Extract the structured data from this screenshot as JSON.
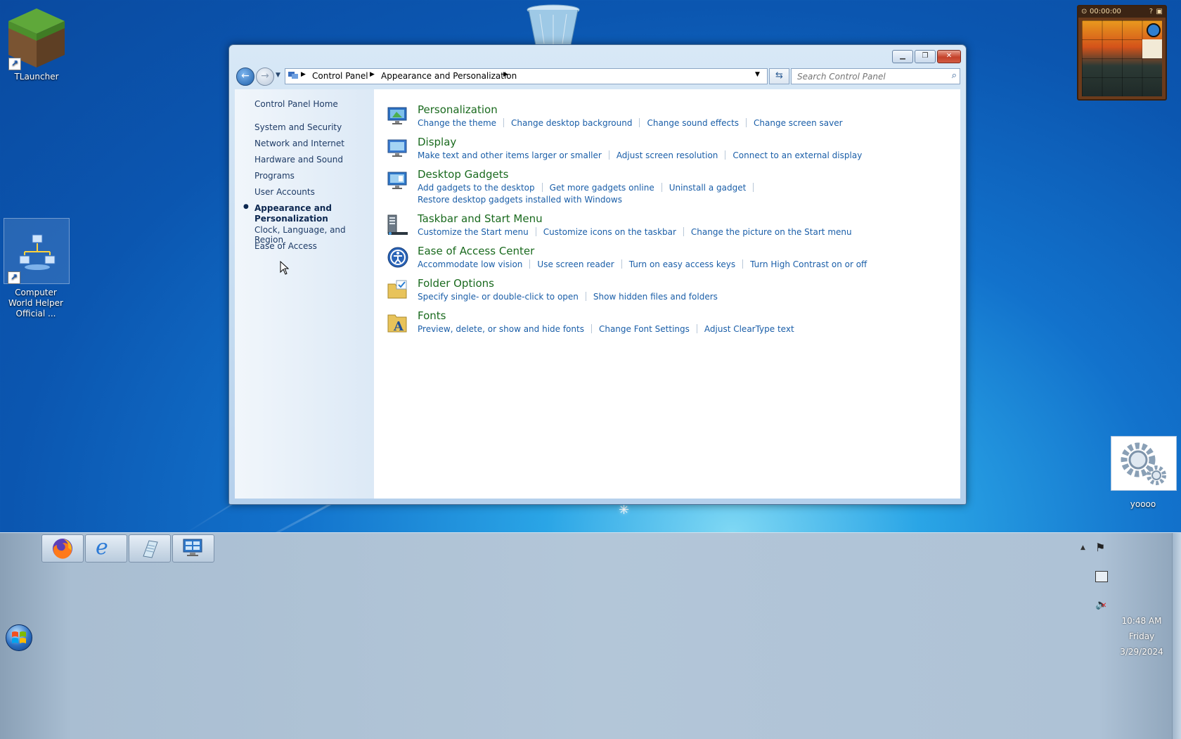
{
  "desktop": {
    "icons": [
      {
        "label": "TLauncher"
      },
      {
        "label": "Computer World Helper Official ..."
      },
      {
        "label": "yoooo"
      }
    ],
    "gadget_timer": "00:00:00"
  },
  "window": {
    "breadcrumb": [
      "Control Panel",
      "Appearance and Personalization"
    ],
    "search_placeholder": "Search Control Panel",
    "left_nav": {
      "home": "Control Panel Home",
      "items": [
        "System and Security",
        "Network and Internet",
        "Hardware and Sound",
        "Programs",
        "User Accounts",
        "Appearance and Personalization",
        "Clock, Language, and Region",
        "Ease of Access"
      ],
      "selected": "Appearance and Personalization"
    },
    "categories": [
      {
        "title": "Personalization",
        "icon": "personalization-icon",
        "links": [
          "Change the theme",
          "Change desktop background",
          "Change sound effects",
          "Change screen saver"
        ]
      },
      {
        "title": "Display",
        "icon": "display-icon",
        "links": [
          "Make text and other items larger or smaller",
          "Adjust screen resolution",
          "Connect to an external display"
        ]
      },
      {
        "title": "Desktop Gadgets",
        "icon": "gadgets-icon",
        "links": [
          "Add gadgets to the desktop",
          "Get more gadgets online",
          "Uninstall a gadget",
          "Restore desktop gadgets installed with Windows"
        ]
      },
      {
        "title": "Taskbar and Start Menu",
        "icon": "taskbar-icon",
        "links": [
          "Customize the Start menu",
          "Customize icons on the taskbar",
          "Change the picture on the Start menu"
        ]
      },
      {
        "title": "Ease of Access Center",
        "icon": "ease-of-access-icon",
        "links": [
          "Accommodate low vision",
          "Use screen reader",
          "Turn on easy access keys",
          "Turn High Contrast on or off"
        ]
      },
      {
        "title": "Folder Options",
        "icon": "folder-options-icon",
        "links": [
          "Specify single- or double-click to open",
          "Show hidden files and folders"
        ]
      },
      {
        "title": "Fonts",
        "icon": "fonts-icon",
        "links": [
          "Preview, delete, or show and hide fonts",
          "Change Font Settings",
          "Adjust ClearType text"
        ]
      }
    ]
  },
  "taskbar": {
    "pinned": [
      "firefox-icon",
      "internet-explorer-icon",
      "notepad-icon",
      "control-panel-icon"
    ],
    "clock": {
      "time": "10:48 AM",
      "day": "Friday",
      "date": "3/29/2024"
    }
  },
  "colors": {
    "link": "#1a5ea8",
    "category_title": "#1a6a1e",
    "nav_text": "#1e3b66"
  }
}
